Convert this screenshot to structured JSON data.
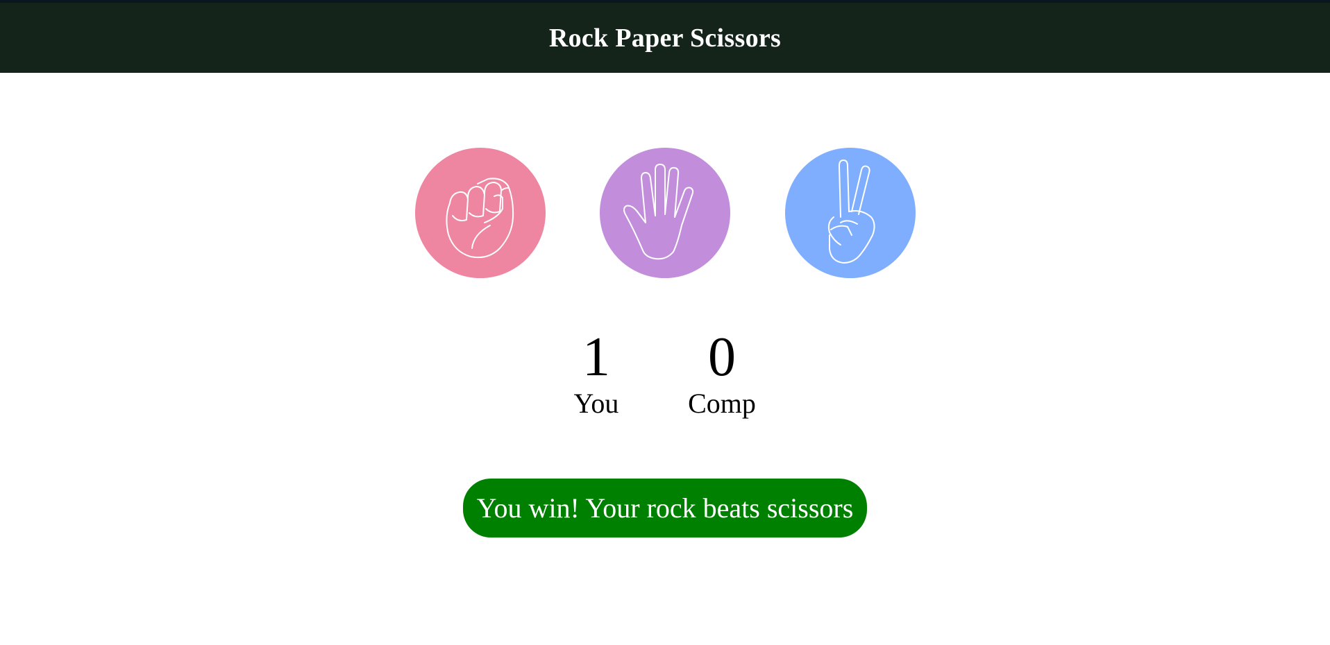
{
  "header": {
    "title": "Rock Paper Scissors"
  },
  "choices": [
    {
      "name": "rock",
      "icon": "rock-fist-icon",
      "color": "#ef86a1"
    },
    {
      "name": "paper",
      "icon": "paper-hand-icon",
      "color": "#c28edc"
    },
    {
      "name": "scissors",
      "icon": "scissors-hand-icon",
      "color": "#80aefe"
    }
  ],
  "score": {
    "you": {
      "value": "1",
      "label": "You"
    },
    "comp": {
      "value": "0",
      "label": "Comp"
    }
  },
  "message": {
    "text": "You win! Your rock beats scissors",
    "color": "#008000"
  },
  "colors": {
    "header_bg": "#14241a",
    "header_text": "#ffffff",
    "page_bg": "#ffffff"
  }
}
